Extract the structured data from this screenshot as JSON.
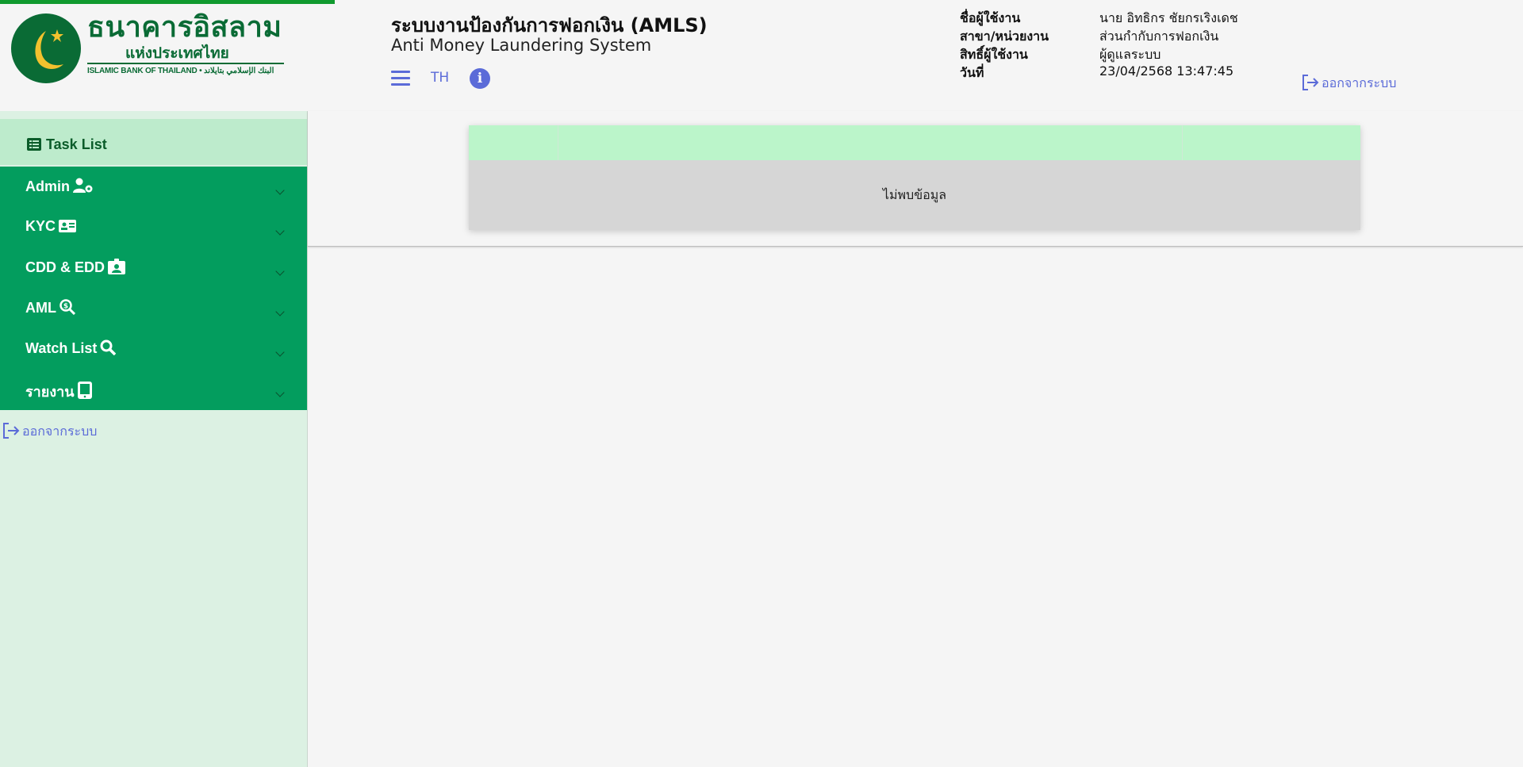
{
  "page": {
    "loading_progress_percent": 22
  },
  "header": {
    "logo": {
      "name_th": "ธนาคารอิสลาม",
      "name_th_line2": "แห่งประเทศไทย",
      "name_en": "ISLAMIC BANK OF THAILAND",
      "name_ar": "البنك الإسلامي بتايلاند"
    },
    "title": "ระบบงานป้องกันการฟอกเงิน (AMLS)",
    "subtitle": "Anti Money Laundering System",
    "lang_label": "TH",
    "icons": {
      "menu": "hamburger-icon",
      "info": "info-icon",
      "logout": "logout-icon"
    },
    "user_info": {
      "username_label": "ชื่อผู้ใช้งาน",
      "username_value": "นาย อิทธิกร ชัยกรเริงเดช",
      "branch_label": "สาขา/หน่วยงาน",
      "branch_value": "ส่วนกำกับการฟอกเงิน",
      "role_label": "สิทธิ์ผู้ใช้งาน",
      "role_value": "ผู้ดูแลระบบ",
      "date_label": "วันที่",
      "date_value": "23/04/2568 13:47:45"
    },
    "logout_label": "ออกจากระบบ"
  },
  "sidebar": {
    "task_list": {
      "label": "Task List",
      "icon": "list-icon"
    },
    "items": [
      {
        "label": "Admin",
        "icon": "user-gear-icon"
      },
      {
        "label": "KYC",
        "icon": "id-card-icon"
      },
      {
        "label": "CDD & EDD",
        "icon": "id-badge-icon"
      },
      {
        "label": "AML",
        "icon": "search-dollar-icon"
      },
      {
        "label": "Watch List",
        "icon": "search-icon"
      },
      {
        "label": "รายงาน",
        "icon": "tablet-icon"
      }
    ],
    "logout_label": "ออกจากระบบ"
  },
  "main": {
    "table": {
      "columns": [
        "",
        "",
        ""
      ],
      "empty_message": "ไม่พบข้อมูล"
    }
  },
  "colors": {
    "accent": "#5b6bd8",
    "menu_green": "#039d5e",
    "brand_green": "#0a6b35",
    "task_list_bg": "#bdebcc",
    "table_header_bg": "#bbf5ca"
  }
}
